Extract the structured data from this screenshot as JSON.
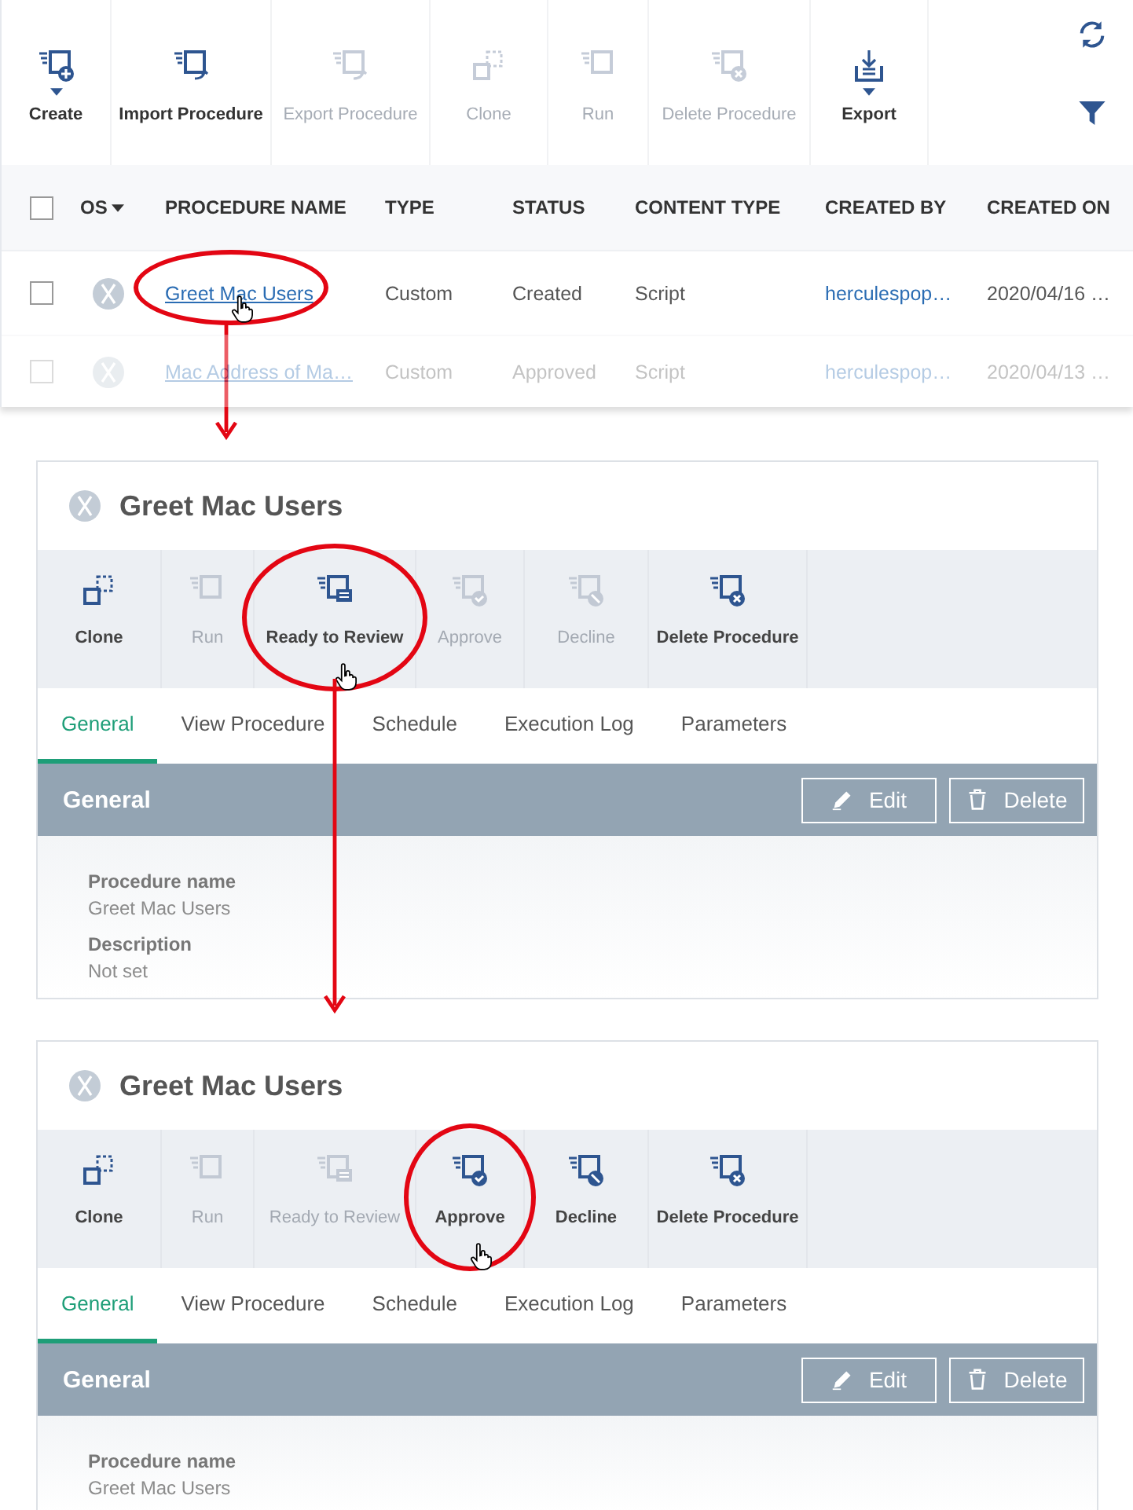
{
  "toolbar": {
    "items": [
      {
        "label": "Create",
        "kind": "create",
        "disabled": false,
        "dropdown": true
      },
      {
        "label": "Import Procedure",
        "kind": "import",
        "disabled": false,
        "dropdown": false
      },
      {
        "label": "Export Procedure",
        "kind": "export",
        "disabled": true,
        "dropdown": false
      },
      {
        "label": "Clone",
        "kind": "clone",
        "disabled": true,
        "dropdown": false
      },
      {
        "label": "Run",
        "kind": "run",
        "disabled": true,
        "dropdown": false
      },
      {
        "label": "Delete Procedure",
        "kind": "delete",
        "disabled": true,
        "dropdown": false
      },
      {
        "label": "Export",
        "kind": "download",
        "disabled": false,
        "dropdown": true
      }
    ]
  },
  "table": {
    "columns": [
      {
        "label": "OS",
        "sorted": true
      },
      {
        "label": "PROCEDURE NAME",
        "sorted": false
      },
      {
        "label": "TYPE",
        "sorted": false
      },
      {
        "label": "STATUS",
        "sorted": false
      },
      {
        "label": "CONTENT TYPE",
        "sorted": false
      },
      {
        "label": "CREATED BY",
        "sorted": false
      },
      {
        "label": "CREATED ON",
        "sorted": false
      }
    ],
    "all_checked": false,
    "rows": [
      {
        "checked": false,
        "faded": false,
        "highlighted": true,
        "name": "Greet Mac Users",
        "type": "Custom",
        "status": "Created",
        "content_type": "Script",
        "created_by": "herculespop…",
        "created_on": "2020/04/16 …"
      },
      {
        "checked": false,
        "faded": true,
        "highlighted": false,
        "name": "Mac Address of Ma…",
        "type": "Custom",
        "status": "Approved",
        "content_type": "Script",
        "created_by": "herculespop…",
        "created_on": "2020/04/13 …"
      }
    ]
  },
  "panels": [
    {
      "title": "Greet Mac Users",
      "arrow": true,
      "actions": [
        {
          "label": "Clone",
          "kind": "clone",
          "disabled": false,
          "highlighted": false
        },
        {
          "label": "Run",
          "kind": "run",
          "disabled": true,
          "highlighted": false
        },
        {
          "label": "Ready to Review",
          "kind": "review",
          "disabled": false,
          "highlighted": true
        },
        {
          "label": "Approve",
          "kind": "approve",
          "disabled": true,
          "highlighted": false
        },
        {
          "label": "Decline",
          "kind": "decline",
          "disabled": true,
          "highlighted": false
        },
        {
          "label": "Delete Procedure",
          "kind": "delete",
          "disabled": false,
          "highlighted": false
        }
      ],
      "tabs": [
        {
          "label": "General",
          "selected": true
        },
        {
          "label": "View Procedure",
          "selected": false
        },
        {
          "label": "Schedule",
          "selected": false
        },
        {
          "label": "Execution Log",
          "selected": false
        },
        {
          "label": "Parameters",
          "selected": false
        }
      ],
      "section": {
        "title": "General",
        "buttons": [
          {
            "label": "Edit",
            "kind": "edit"
          },
          {
            "label": "Delete",
            "kind": "trash"
          }
        ],
        "fields": [
          {
            "label": "Procedure name",
            "value": "Greet Mac Users"
          },
          {
            "label": "Description",
            "value": "Not set"
          }
        ]
      }
    },
    {
      "title": "Greet Mac Users",
      "arrow": false,
      "actions": [
        {
          "label": "Clone",
          "kind": "clone",
          "disabled": false,
          "highlighted": false
        },
        {
          "label": "Run",
          "kind": "run",
          "disabled": true,
          "highlighted": false
        },
        {
          "label": "Ready to Review",
          "kind": "review",
          "disabled": true,
          "highlighted": false
        },
        {
          "label": "Approve",
          "kind": "approve",
          "disabled": false,
          "highlighted": true
        },
        {
          "label": "Decline",
          "kind": "decline",
          "disabled": false,
          "highlighted": false
        },
        {
          "label": "Delete Procedure",
          "kind": "delete",
          "disabled": false,
          "highlighted": false
        }
      ],
      "tabs": [
        {
          "label": "General",
          "selected": true
        },
        {
          "label": "View Procedure",
          "selected": false
        },
        {
          "label": "Schedule",
          "selected": false
        },
        {
          "label": "Execution Log",
          "selected": false
        },
        {
          "label": "Parameters",
          "selected": false
        }
      ],
      "section": {
        "title": "General",
        "buttons": [
          {
            "label": "Edit",
            "kind": "edit"
          },
          {
            "label": "Delete",
            "kind": "trash"
          }
        ],
        "fields": [
          {
            "label": "Procedure name",
            "value": "Greet Mac Users"
          }
        ]
      }
    }
  ]
}
